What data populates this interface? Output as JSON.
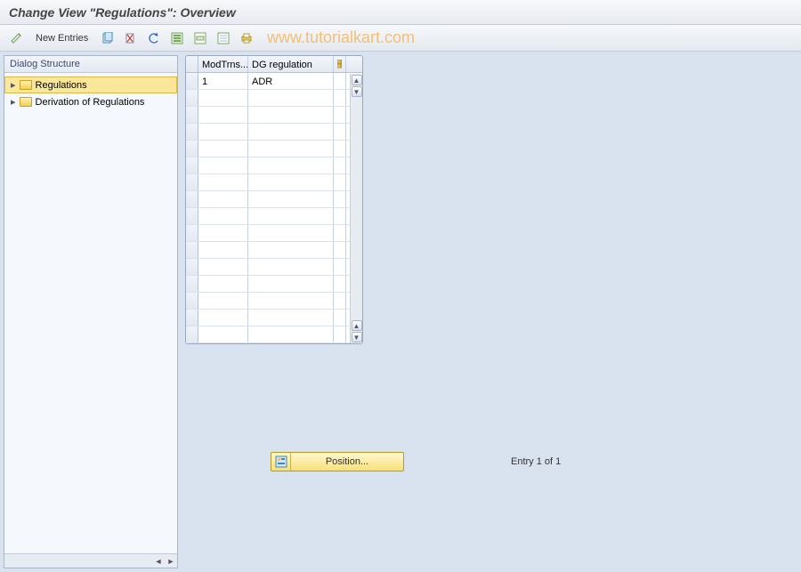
{
  "title": "Change View \"Regulations\": Overview",
  "watermark": "www.tutorialkart.com",
  "toolbar": {
    "new_entries": "New Entries"
  },
  "sidebar": {
    "header": "Dialog Structure",
    "items": [
      {
        "label": "Regulations",
        "selected": true
      },
      {
        "label": "Derivation of Regulations",
        "selected": false
      }
    ]
  },
  "table": {
    "columns": [
      "ModTrns...",
      "DG regulation"
    ],
    "rows": [
      {
        "c1": "1",
        "c2": "ADR"
      },
      {
        "c1": "",
        "c2": ""
      },
      {
        "c1": "",
        "c2": ""
      },
      {
        "c1": "",
        "c2": ""
      },
      {
        "c1": "",
        "c2": ""
      },
      {
        "c1": "",
        "c2": ""
      },
      {
        "c1": "",
        "c2": ""
      },
      {
        "c1": "",
        "c2": ""
      },
      {
        "c1": "",
        "c2": ""
      },
      {
        "c1": "",
        "c2": ""
      },
      {
        "c1": "",
        "c2": ""
      },
      {
        "c1": "",
        "c2": ""
      },
      {
        "c1": "",
        "c2": ""
      },
      {
        "c1": "",
        "c2": ""
      },
      {
        "c1": "",
        "c2": ""
      },
      {
        "c1": "",
        "c2": ""
      }
    ]
  },
  "footer": {
    "position": "Position...",
    "entry": "Entry 1 of 1"
  }
}
